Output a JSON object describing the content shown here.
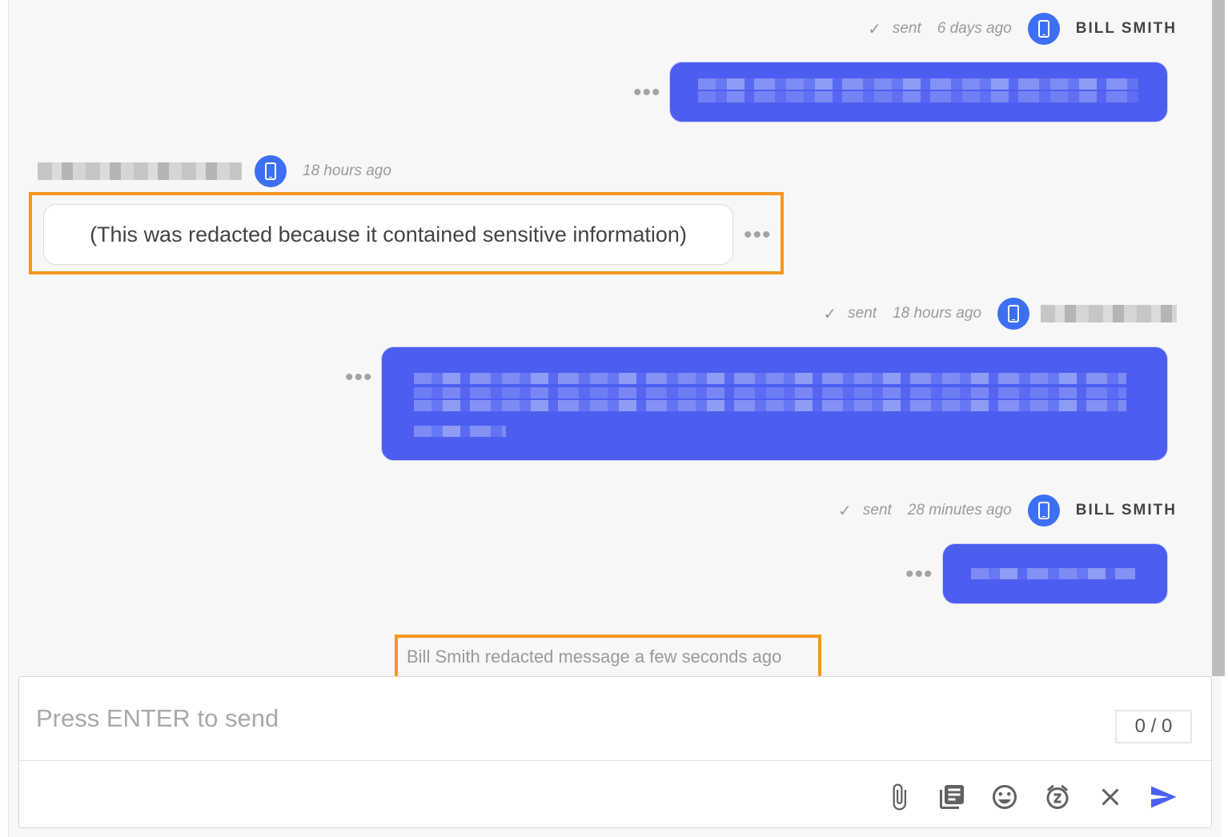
{
  "conversation": {
    "messages": [
      {
        "direction": "outgoing",
        "status": "sent",
        "time": "6 days ago",
        "sender": "BILL SMITH",
        "device_icon": "phone-icon",
        "content": "[pixelated]"
      },
      {
        "direction": "incoming",
        "time": "18 hours ago",
        "sender": "[pixelated]",
        "device_icon": "phone-icon",
        "content": "(This was redacted because it contained sensitive information)",
        "highlighted": true
      },
      {
        "direction": "outgoing",
        "status": "sent",
        "time": "18 hours ago",
        "sender": "[pixelated]",
        "device_icon": "phone-icon",
        "content": "[pixelated]"
      },
      {
        "direction": "outgoing",
        "status": "sent",
        "time": "28 minutes ago",
        "sender": "BILL SMITH",
        "device_icon": "phone-icon",
        "content": "[pixelated]"
      }
    ],
    "event_text": "Bill Smith redacted message a few seconds ago",
    "more_label": "•••",
    "check_glyph": "✓"
  },
  "composer": {
    "placeholder": "Press ENTER to send",
    "value": "",
    "counter": "0 / 0",
    "tools": [
      "paperclip-icon",
      "templates-icon",
      "emoji-icon",
      "snooze-icon",
      "close-icon",
      "send-icon"
    ]
  },
  "colors": {
    "accent": "#4c5ef0",
    "device_badge": "#3d6ff2",
    "highlight": "#f5961f",
    "muted_text": "#9a9a9a"
  }
}
